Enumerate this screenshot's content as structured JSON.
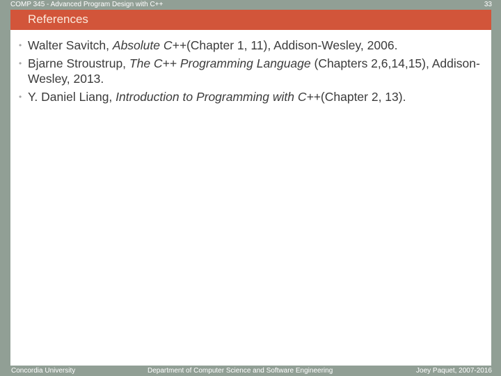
{
  "header": {
    "course_title": "COMP 345 - Advanced Program Design with C++",
    "slide_number": "33"
  },
  "slide": {
    "title": "References",
    "references": [
      {
        "author": "Walter Savitch, ",
        "book": "Absolute C++",
        "details": "(Chapter 1, 11), Addison-Wesley, 2006."
      },
      {
        "author": "Bjarne Stroustrup, ",
        "book": "The C++ Programming Language",
        "details": " (Chapters 2,6,14,15), Addison-Wesley, 2013."
      },
      {
        "author": "Y. Daniel Liang, ",
        "book": "Introduction to Programming with C++",
        "details": "(Chapter 2, 13)."
      }
    ],
    "bullet_glyph": "•"
  },
  "footer": {
    "left": "Concordia University",
    "center": "Department of Computer Science and Software Engineering",
    "right": "Joey Paquet, 2007-2016"
  },
  "colors": {
    "frame": "#919f95",
    "title_band": "#d2553a",
    "slide_bg": "#ffffff"
  }
}
